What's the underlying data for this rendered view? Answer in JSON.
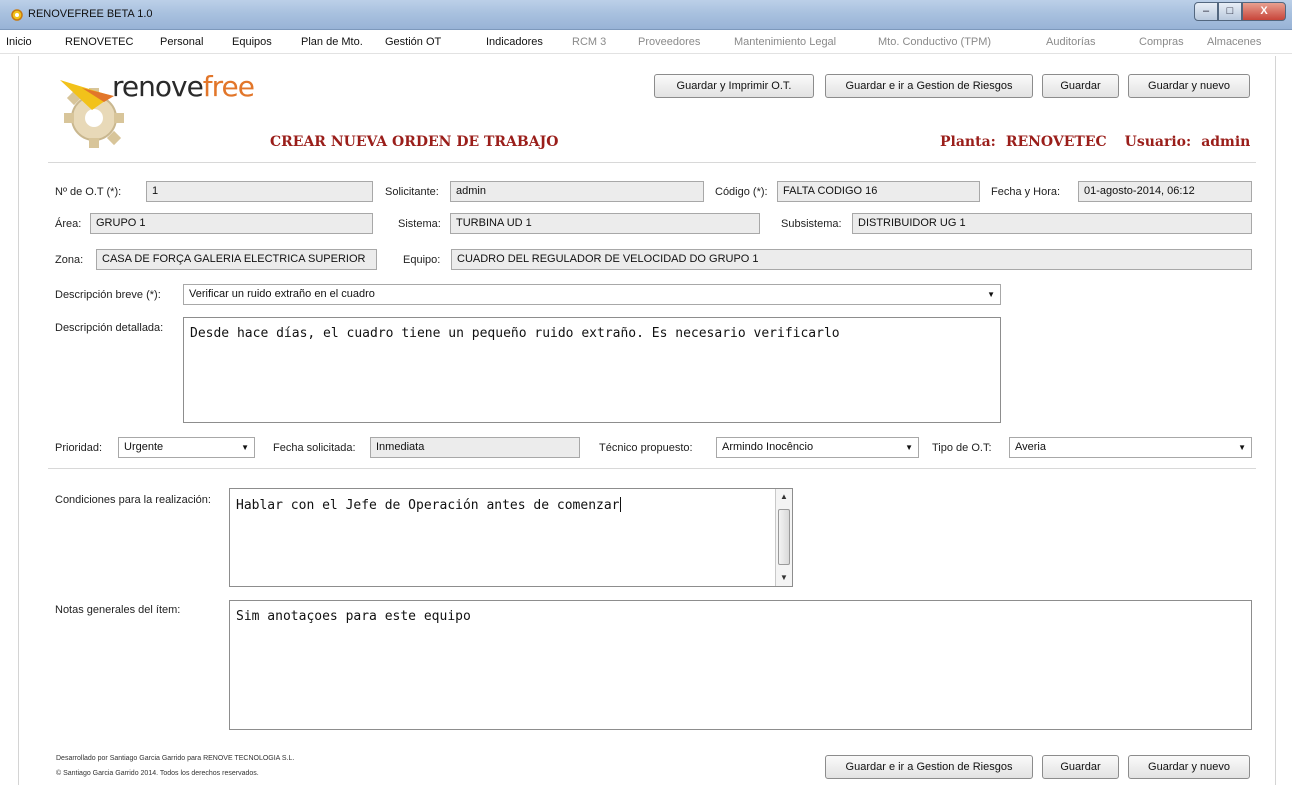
{
  "window": {
    "title": "RENOVEFREE BETA 1.0",
    "controls": {
      "minimize": "–",
      "maximize": "□",
      "close": "X"
    }
  },
  "menu": {
    "items": [
      {
        "label": "Inicio",
        "enabled": true
      },
      {
        "label": "RENOVETEC",
        "enabled": true
      },
      {
        "label": "Personal",
        "enabled": true
      },
      {
        "label": "Equipos",
        "enabled": true
      },
      {
        "label": "Plan de Mto.",
        "enabled": true
      },
      {
        "label": "Gestión OT",
        "enabled": true
      },
      {
        "label": "Indicadores",
        "enabled": true
      },
      {
        "label": "RCM 3",
        "enabled": false
      },
      {
        "label": "Proveedores",
        "enabled": false
      },
      {
        "label": "Mantenimiento Legal",
        "enabled": false
      },
      {
        "label": "Mto. Conductivo (TPM)",
        "enabled": false
      },
      {
        "label": "Auditorías",
        "enabled": false
      },
      {
        "label": "Compras",
        "enabled": false
      },
      {
        "label": "Almacenes",
        "enabled": false
      }
    ]
  },
  "logo": {
    "text_part1": "renove",
    "text_part2": "free"
  },
  "toolbar_top": {
    "save_print": "Guardar y Imprimir O.T.",
    "save_risk": "Guardar e ir a Gestion de Riesgos",
    "save": "Guardar",
    "save_new": "Guardar y nuevo"
  },
  "header": {
    "page_title": "CREAR NUEVA ORDEN DE TRABAJO",
    "plant_label": "Planta:",
    "plant_value": "RENOVETEC",
    "user_label": "Usuario:",
    "user_value": "admin"
  },
  "form": {
    "ot_number": {
      "label": "Nº de O.T (*):",
      "value": "1"
    },
    "requester": {
      "label": "Solicitante:",
      "value": "admin"
    },
    "code": {
      "label": "Código (*):",
      "value": "FALTA CODIGO 16"
    },
    "datetime": {
      "label": "Fecha y Hora:",
      "value": "01-agosto-2014, 06:12"
    },
    "area": {
      "label": "Área:",
      "value": "GRUPO 1"
    },
    "system": {
      "label": "Sistema:",
      "value": "TURBINA UD 1"
    },
    "subsystem": {
      "label": "Subsistema:",
      "value": "DISTRIBUIDOR UG 1"
    },
    "zone": {
      "label": "Zona:",
      "value": "CASA DE FORÇA GALERIA ELECTRICA SUPERIOR"
    },
    "equipment": {
      "label": "Equipo:",
      "value": "CUADRO DEL REGULADOR DE VELOCIDAD DO GRUPO 1"
    },
    "short_desc": {
      "label": "Descripción breve (*):",
      "value": "Verificar un ruido extraño en el cuadro"
    },
    "detailed_desc": {
      "label": "Descripción detallada:",
      "value": "Desde hace días, el cuadro tiene un pequeño ruido extraño. Es necesario verificarlo"
    },
    "priority": {
      "label": "Prioridad:",
      "value": "Urgente"
    },
    "requested_date": {
      "label": "Fecha solicitada:",
      "value": "Inmediata"
    },
    "technician": {
      "label": "Técnico propuesto:",
      "value": "Armindo  Inocêncio"
    },
    "ot_type": {
      "label": "Tipo de O.T:",
      "value": "Averia"
    },
    "conditions": {
      "label": "Condiciones para la realización:",
      "value": "Hablar con el Jefe de Operación antes de comenzar"
    },
    "notes": {
      "label": "Notas generales del ítem:",
      "value": "Sim anotaçoes para este equipo"
    }
  },
  "toolbar_bottom": {
    "save_risk": "Guardar e ir a Gestion de Riesgos",
    "save": "Guardar",
    "save_new": "Guardar y nuevo"
  },
  "footer": {
    "line1": "Desarrollado por Santiago Garcia Garrido para RENOVE TECNOLOGIA S.L.",
    "line2": "© Santiago Garcia Garrido 2014. Todos los derechos reservados."
  },
  "icons": {
    "app": "gear-icon",
    "dropdown": "chevron-down-icon",
    "scroll_up": "arrow-up-icon",
    "scroll_down": "arrow-down-icon"
  },
  "colors": {
    "accent_red": "#9a1e1a",
    "logo_orange": "#e2762a",
    "logo_yellow": "#f2c21a",
    "field_bg": "#ececec"
  }
}
